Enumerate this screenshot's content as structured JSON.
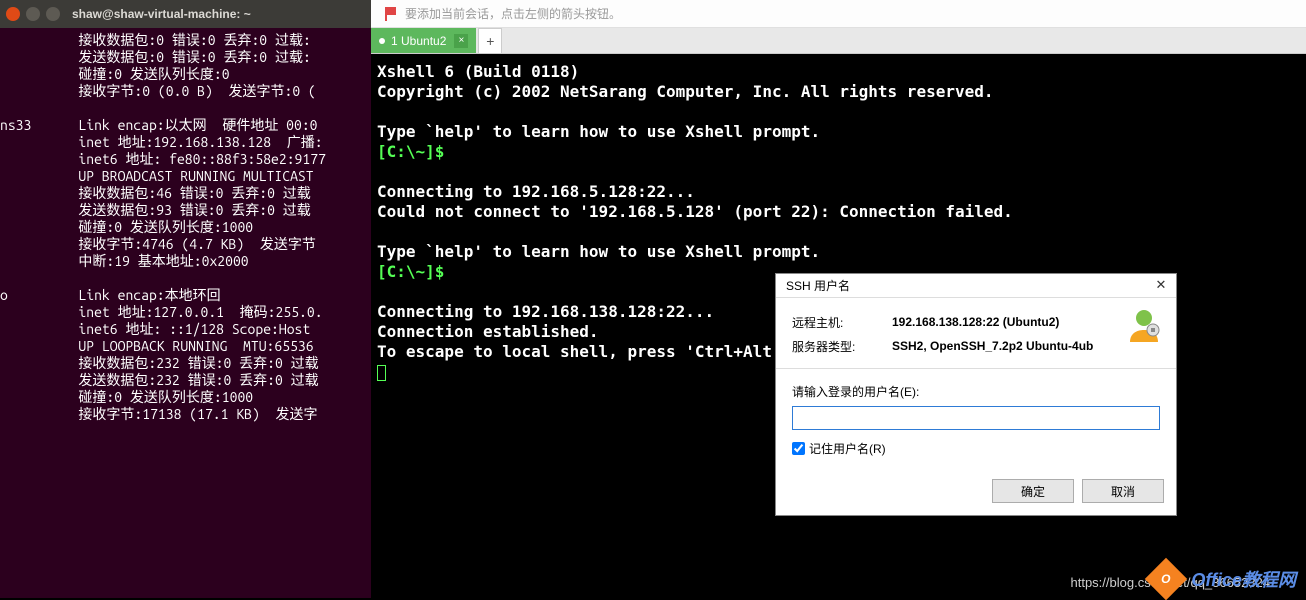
{
  "ubuntu": {
    "title": "shaw@shaw-virtual-machine: ~",
    "body": "          接收数据包:0 错误:0 丢弃:0 过载:\n          发送数据包:0 错误:0 丢弃:0 过载:\n          碰撞:0 发送队列长度:0\n          接收字节:0 (0.0 B)  发送字节:0 (\n\nns33      Link encap:以太网  硬件地址 00:0\n          inet 地址:192.168.138.128  广播:\n          inet6 地址: fe80::88f3:58e2:9177\n          UP BROADCAST RUNNING MULTICAST \n          接收数据包:46 错误:0 丢弃:0 过载\n          发送数据包:93 错误:0 丢弃:0 过载\n          碰撞:0 发送队列长度:1000\n          接收字节:4746 (4.7 KB)  发送字节\n          中断:19 基本地址:0x2000\n\no         Link encap:本地环回\n          inet 地址:127.0.0.1  掩码:255.0.\n          inet6 地址: ::1/128 Scope:Host\n          UP LOOPBACK RUNNING  MTU:65536 \n          接收数据包:232 错误:0 丢弃:0 过载\n          发送数据包:232 错误:0 丢弃:0 过载\n          碰撞:0 发送队列长度:1000\n          接收字节:17138 (17.1 KB)  发送字"
  },
  "xshell": {
    "hint": "要添加当前会话，点击左侧的箭头按钮。",
    "tab_label": "1 Ubuntu2",
    "lines": {
      "l1": "Xshell 6 (Build 0118)",
      "l2": "Copyright (c) 2002 NetSarang Computer, Inc. All rights reserved.",
      "l3": "Type `help' to learn how to use Xshell prompt.",
      "p1": "[C:\\~]$",
      "l4": "Connecting to 192.168.5.128:22...",
      "l5": "Could not connect to '192.168.5.128' (port 22): Connection failed.",
      "l6": "Type `help' to learn how to use Xshell prompt.",
      "p2": "[C:\\~]$",
      "l7": "Connecting to 192.168.138.128:22...",
      "l8": "Connection established.",
      "l9": "To escape to local shell, press 'Ctrl+Alt"
    }
  },
  "dialog": {
    "title": "SSH 用户名",
    "host_label": "远程主机:",
    "host_value": "192.168.138.128:22 (Ubuntu2)",
    "type_label": "服务器类型:",
    "type_value": "SSH2, OpenSSH_7.2p2 Ubuntu-4ub",
    "prompt": "请输入登录的用户名(E):",
    "username_value": "",
    "remember_label": "记住用户名(R)",
    "ok": "确定",
    "cancel": "取消"
  },
  "watermark": {
    "text": "Office教程网",
    "url": "https://blog.csdn.net/qq_36652324"
  }
}
